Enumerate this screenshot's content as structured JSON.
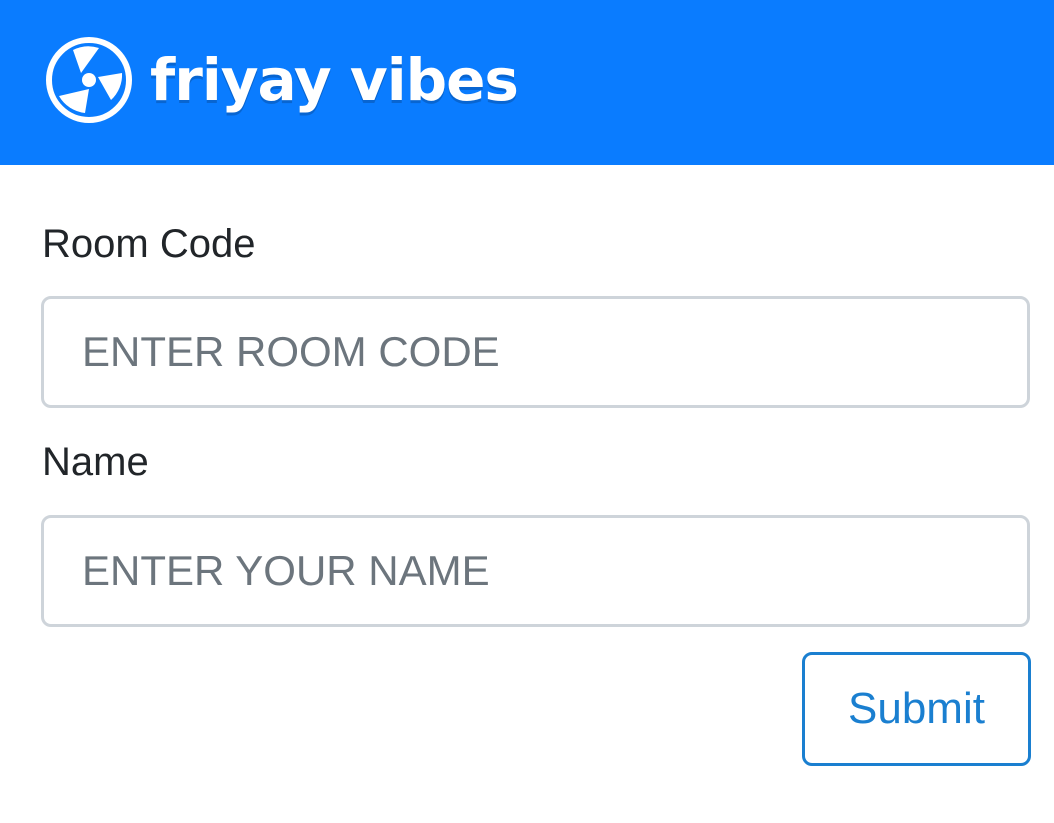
{
  "header": {
    "brand_name": "friyay vibes",
    "logo_icon": "fan-icon",
    "background_color": "#0a7cff"
  },
  "form": {
    "room_code": {
      "label": "Room Code",
      "placeholder": "ENTER ROOM CODE",
      "value": ""
    },
    "name": {
      "label": "Name",
      "placeholder": "ENTER YOUR NAME",
      "value": ""
    },
    "submit_label": "Submit",
    "accent_color": "#1a7fd0"
  }
}
